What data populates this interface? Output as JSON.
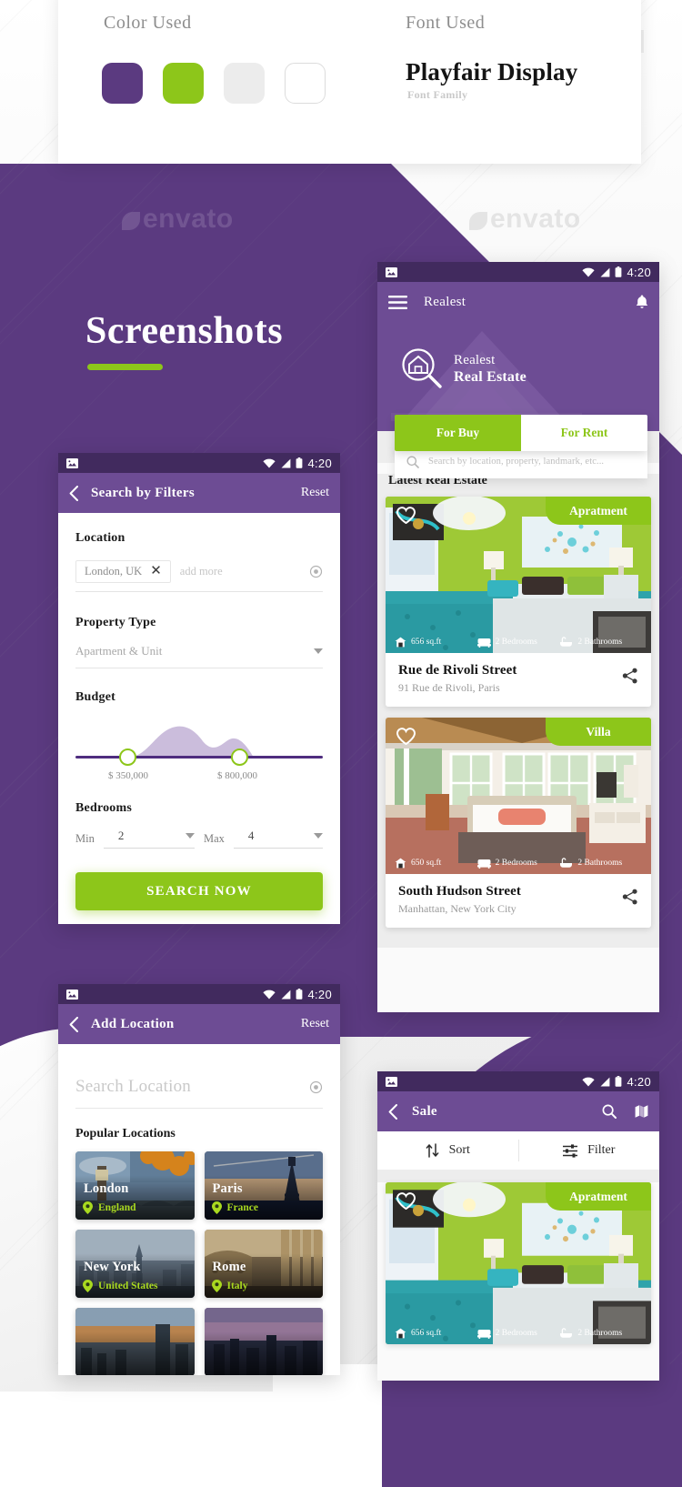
{
  "spec": {
    "color_title": "Color Used",
    "font_title": "Font Used",
    "font_name": "Playfair Display",
    "font_sub": "Font Family",
    "swatches": [
      {
        "name": "primary-purple",
        "hex": "#5B3A80"
      },
      {
        "name": "accent-green",
        "hex": "#8DC61A"
      },
      {
        "name": "light-grey",
        "hex": "#ECECEC"
      },
      {
        "name": "white-outline",
        "hex": "#FFFFFF"
      }
    ]
  },
  "headline": {
    "title": "Screenshots"
  },
  "watermarks": {
    "brand": "envato"
  },
  "status_bar": {
    "time": "4:20",
    "icons": [
      "image-icon",
      "wifi-icon",
      "signal-icon",
      "battery-icon"
    ]
  },
  "filters_screen": {
    "title": "Search by Filters",
    "reset_label": "Reset",
    "back_icon": "chevron-left-icon",
    "location": {
      "label": "Location",
      "chip_value": "London, UK",
      "chip_remove_icon": "close-icon",
      "placeholder": "add more",
      "locate_icon": "crosshair-icon"
    },
    "property_type": {
      "label": "Property Type",
      "value": "Apartment & Unit",
      "caret_icon": "chevron-down-icon"
    },
    "budget": {
      "label": "Budget",
      "min_value": "$ 350,000",
      "max_value": "$ 800,000",
      "min_pct": 21,
      "max_pct": 66
    },
    "bedrooms": {
      "label": "Bedrooms",
      "min_label": "Min",
      "min_value": "2",
      "max_label": "Max",
      "max_value": "4"
    },
    "submit_label": "SEARCH NOW"
  },
  "home_screen": {
    "app_title": "Realest",
    "menu_icon": "hamburger-menu-icon",
    "bell_icon": "notification-bell-icon",
    "hero": {
      "logo_icon": "house-magnifier-icon",
      "line1": "Realest",
      "line2": "Real Estate"
    },
    "tabs": [
      {
        "label": "For Buy",
        "active": true
      },
      {
        "label": "For Rent",
        "active": false
      }
    ],
    "search": {
      "placeholder": "Search by location, property, landmark, etc...",
      "icon": "search-icon"
    },
    "section_title": "Latest Real Estate",
    "cards": [
      {
        "badge": "Apratment",
        "favorite_icon": "heart-icon",
        "area": "656 sq.ft",
        "bedrooms": "2 Bedrooms",
        "bathrooms": "2 Bathrooms",
        "title": "Rue de Rivoli Street",
        "subtitle": "91 Rue de Rivoli, Paris",
        "share_icon": "share-icon",
        "theme": "green-bedroom"
      },
      {
        "badge": "Villa",
        "favorite_icon": "heart-icon",
        "area": "650 sq.ft",
        "bedrooms": "2 Bedrooms",
        "bathrooms": "2 Bathrooms",
        "title": "South Hudson Street",
        "subtitle": "Manhattan, New York City",
        "share_icon": "share-icon",
        "theme": "white-bedroom"
      }
    ]
  },
  "add_location_screen": {
    "title": "Add Location",
    "reset_label": "Reset",
    "back_icon": "chevron-left-icon",
    "search_placeholder": "Search Location",
    "locate_icon": "crosshair-icon",
    "popular_title": "Popular  Locations",
    "locations": [
      {
        "city": "London",
        "country": "England",
        "pin_icon": "map-pin-icon"
      },
      {
        "city": "Paris",
        "country": "France",
        "pin_icon": "map-pin-icon"
      },
      {
        "city": "New York",
        "country": "United States",
        "pin_icon": "map-pin-icon"
      },
      {
        "city": "Rome",
        "country": "Italy",
        "pin_icon": "map-pin-icon"
      },
      {
        "city": "",
        "country": "",
        "pin_icon": "map-pin-icon"
      },
      {
        "city": "",
        "country": "",
        "pin_icon": "map-pin-icon"
      }
    ]
  },
  "sale_screen": {
    "title": "Sale",
    "back_icon": "chevron-left-icon",
    "search_icon": "search-icon",
    "map_icon": "map-icon",
    "sort_label": "Sort",
    "sort_icon": "sort-arrows-icon",
    "filter_label": "Filter",
    "filter_icon": "filter-sliders-icon",
    "card": {
      "badge": "Apratment",
      "favorite_icon": "heart-icon",
      "area": "656 sq.ft",
      "bedrooms": "2 Bedrooms",
      "bathrooms": "2 Bathrooms",
      "share_icon": "share-icon"
    }
  }
}
